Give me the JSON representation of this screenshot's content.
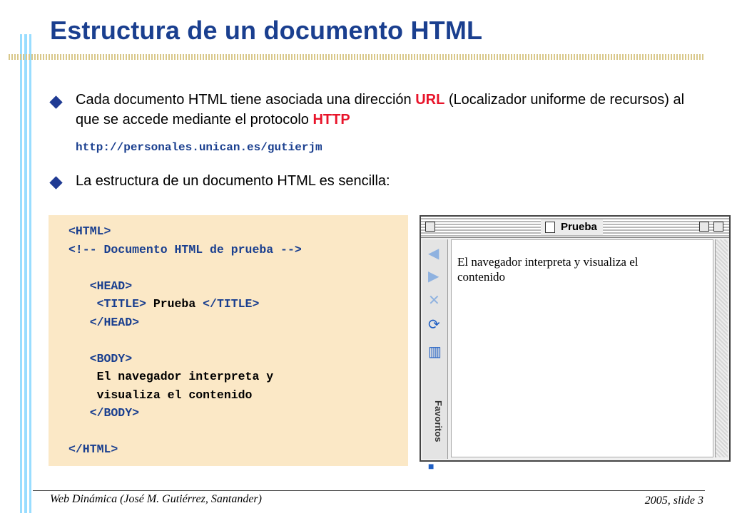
{
  "slide": {
    "title": "Estructura de un documento HTML",
    "colors": {
      "title": "#1a3f8f",
      "highlight": "#e8142a",
      "codebox": "#fbe8c6",
      "bars": "#99ddff"
    }
  },
  "bullets": [
    {
      "text_before": "Cada documento HTML tiene asociada una dirección ",
      "hl1": "URL",
      "text_mid": " (Localizador uniforme de recursos) al que se accede mediante el protocolo ",
      "hl2": "HTTP"
    },
    {
      "text": "La estructura de un documento HTML es sencilla:"
    }
  ],
  "url": "http://personales.unican.es/gutierjm",
  "code": {
    "l1": "<HTML>",
    "l2": "<!-- Documento HTML de prueba -->",
    "l3": "",
    "l4": "   <HEAD>",
    "l5_open": "    <TITLE>",
    "l5_text": " Prueba ",
    "l5_close": "</TITLE>",
    "l6": "   </HEAD>",
    "l7": "",
    "l8": "   <BODY>",
    "l9": "    El navegador interpreta y",
    "l10": "    visualiza el contenido",
    "l11": "   </BODY>",
    "l12": "",
    "l13": "</HTML>"
  },
  "browser": {
    "title": "Prueba",
    "content": "El navegador interpreta y visualiza el contenido",
    "sidebar_tab": "Favoritos",
    "icons": [
      "back-arrow-icon",
      "forward-arrow-icon",
      "stop-icon",
      "refresh-icon",
      "toolbar-icon",
      "page-icon"
    ]
  },
  "footer": {
    "left": "Web Dinámica (José M. Gutiérrez, Santander)",
    "right": "2005, slide 3"
  }
}
